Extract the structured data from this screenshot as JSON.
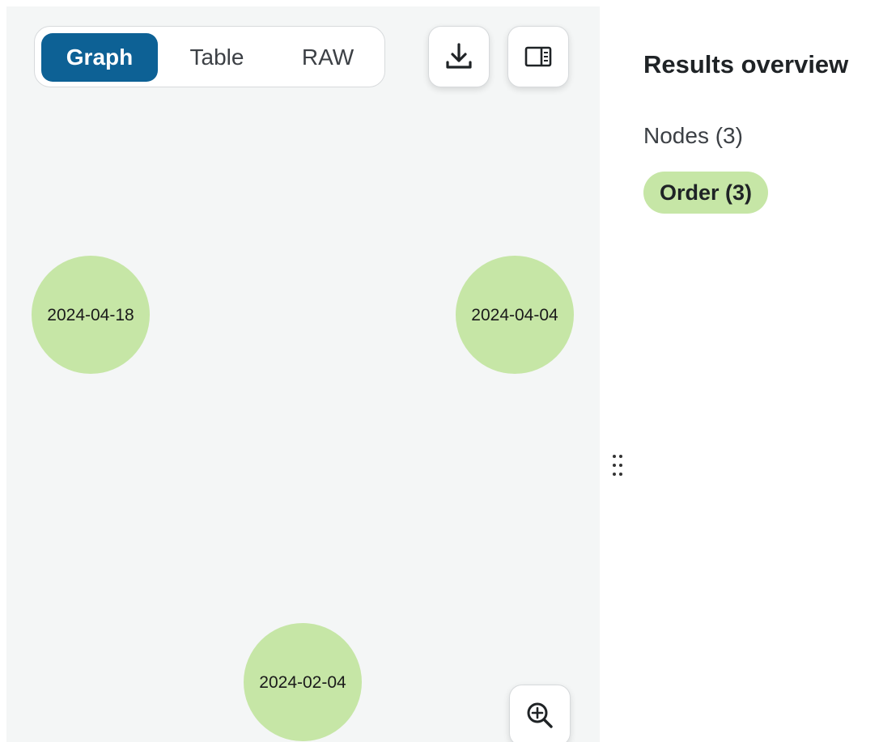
{
  "view_switch": {
    "options": [
      {
        "label": "Graph",
        "active": true
      },
      {
        "label": "Table",
        "active": false
      },
      {
        "label": "RAW",
        "active": false
      }
    ]
  },
  "toolbar": {
    "download_icon": "download-icon",
    "toggle_panel_icon": "side-panel-icon",
    "zoom_icon": "zoom-in-icon"
  },
  "graph": {
    "node_color": "#c6e6a6",
    "nodes": [
      {
        "label": "2024-04-18"
      },
      {
        "label": "2024-04-04"
      },
      {
        "label": "2024-02-04"
      }
    ]
  },
  "sidebar": {
    "title": "Results overview",
    "nodes_label": "Nodes (3)",
    "labels": [
      {
        "label": "Order (3)",
        "color": "#c6e6a6"
      }
    ]
  },
  "colors": {
    "accent": "#0d6195",
    "canvas_bg": "#f4f6f6"
  }
}
